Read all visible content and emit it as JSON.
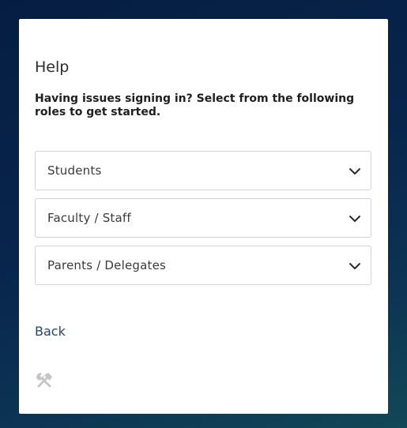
{
  "help": {
    "title": "Help",
    "subtitle": "Having issues signing in? Select from the following roles to get started.",
    "roles": [
      {
        "label": "Students"
      },
      {
        "label": "Faculty / Staff"
      },
      {
        "label": "Parents / Delegates"
      }
    ],
    "back_label": "Back"
  },
  "icons": {
    "role_toggle": "chevron-down-icon",
    "footer": "tools-icon"
  },
  "colors": {
    "background_dark": "#061d42",
    "background_teal": "#124857",
    "card": "#ffffff",
    "border": "#cfd4d9",
    "link": "#2a4461",
    "icon_muted": "#c6c6c6"
  }
}
